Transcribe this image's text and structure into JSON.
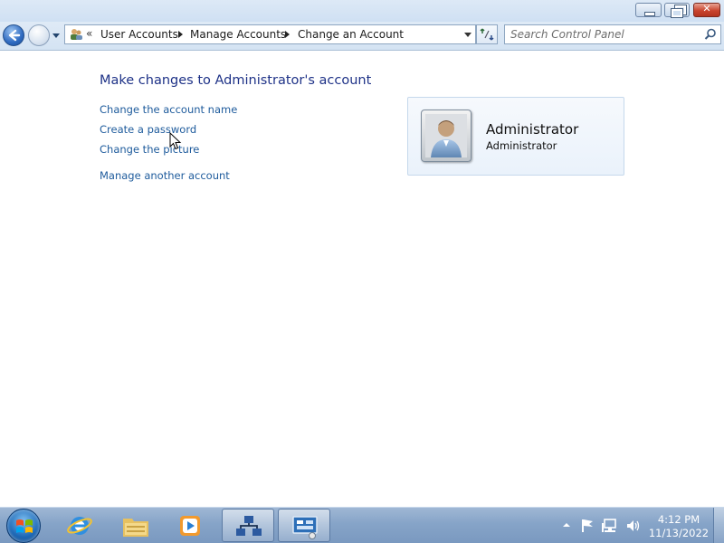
{
  "window": {
    "caption_buttons": {
      "minimize": "minimize-icon",
      "restore": "restore-icon",
      "close": "close-icon"
    }
  },
  "nav": {
    "back_icon": "back-arrow-icon",
    "forward_icon": "forward-arrow-icon",
    "breadcrumb_overflow": "«",
    "breadcrumbs": [
      "User Accounts",
      "Manage Accounts",
      "Change an Account"
    ],
    "search_placeholder": "Search Control Panel"
  },
  "main": {
    "heading": "Make changes to Administrator's account",
    "tasks": [
      "Change the account name",
      "Create a password",
      "Change the picture"
    ],
    "other_task": "Manage another account",
    "account": {
      "name": "Administrator",
      "type": "Administrator",
      "avatar_icon": "user-avatar-icon"
    }
  },
  "taskbar": {
    "pinned": [
      "start-orb-icon",
      "internet-explorer-icon",
      "windows-explorer-icon",
      "media-player-icon",
      "network-icon",
      "control-panel-icon"
    ],
    "tray_icons": [
      "show-hidden-icons-icon",
      "action-center-flag-icon",
      "network-status-icon",
      "volume-icon"
    ],
    "clock_time": "4:12 PM",
    "clock_date": "11/13/2022"
  },
  "colors": {
    "link": "#1e5b9c",
    "heading": "#1e3287",
    "taskbar": "#86a4c8"
  }
}
